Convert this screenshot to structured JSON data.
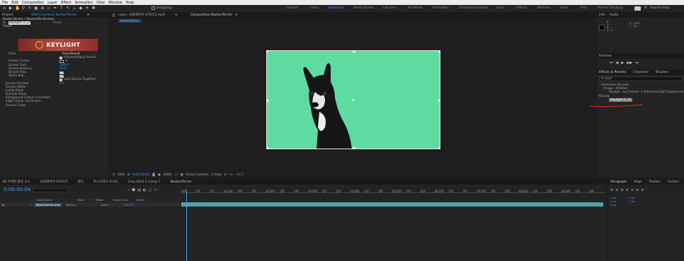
{
  "menubar": [
    "File",
    "Edit",
    "Composition",
    "Layer",
    "Effect",
    "Animation",
    "View",
    "Window",
    "Help"
  ],
  "workspaces": [
    "Default",
    "Learn",
    "Standard",
    "Small Screen",
    "Libraries",
    "All Panels",
    "Animation",
    "Essential Graphics",
    "Color",
    "Effects",
    "Minimal",
    "Paint",
    "Text",
    "Motion Tracking"
  ],
  "toolbar": {
    "snapping_label": "Snapping",
    "search_placeholder": "Search Help"
  },
  "effect_controls": {
    "tab_project": "Project",
    "tab_label": "Effect Controls BostonTerrier",
    "header": "BostonTerrier • BostonTerrier.mov",
    "effect_name": "Keylight (1.2)",
    "reset_label": "Reset",
    "about_label": "About",
    "logo_text": "KEYLIGHT",
    "props": [
      {
        "name": "View",
        "value": "Final Result"
      },
      {
        "name": "",
        "value": "Unpremultiply Result",
        "checkbox": true
      },
      {
        "name": "Screen Colour",
        "value": ""
      },
      {
        "name": "Screen Gain",
        "value": "100.0"
      },
      {
        "name": "Screen Balance",
        "value": "50.0"
      },
      {
        "name": "Despill Bias",
        "value": ""
      },
      {
        "name": "Alpha Bias",
        "value": ""
      },
      {
        "name": "",
        "value": "Lock Biases Together",
        "checkbox": true
      },
      {
        "name": "Screen Pre-blur",
        "value": "0.0"
      },
      {
        "name": "Screen Matte",
        "value": ""
      },
      {
        "name": "Inside Mask",
        "value": ""
      },
      {
        "name": "Outside Mask",
        "value": ""
      },
      {
        "name": "Foreground Colour Correction",
        "value": ""
      },
      {
        "name": "Edge Colour Correction",
        "value": ""
      },
      {
        "name": "Source Crops",
        "value": ""
      }
    ]
  },
  "viewer": {
    "tab_layer": "Layer: 보정레이어-모자이크.mp4",
    "tab_comp": "Composition BostonTerrier",
    "comp_chip": "BostonTerrier",
    "zoom": "50%",
    "timecode": "0:00:00:04",
    "resolution": "(Half)",
    "camera": "Active Camera",
    "views": "1 View",
    "offset": "+0.0"
  },
  "right_panel": {
    "tab_info": "Info",
    "tab_audio": "Audio",
    "info_lines": [
      "R :",
      "G :",
      "B :",
      "A : 0"
    ],
    "info_xy": [
      "X : 2424",
      "Y : 30"
    ],
    "tab_preview": "Preview",
    "tab_effects": "Effects & Presets",
    "tab_character": "Character",
    "tab_brushes": "Brushes",
    "search_value": "keyli",
    "tree": [
      {
        "label": "* Animation Presets",
        "indent": 0
      },
      {
        "label": "Image - Utilities",
        "indent": 1
      },
      {
        "label": "Keyligh...ey Cleaner + Advanced Spill Suppressor",
        "indent": 2
      },
      {
        "label": "Keying",
        "indent": 0
      },
      {
        "label": "Keylight (1.2)",
        "indent": 2,
        "selected": true
      }
    ]
  },
  "timeline": {
    "tabs": [
      "3D 트래킹 합성 소스",
      "보정레이어-모자이크",
      "렌더",
      "마스크리브 모니터",
      "Gray Solid 2 Comp 1",
      "BostonTerrier"
    ],
    "timecode": "0:00:00:04",
    "search_placeholder": "",
    "columns": [
      "Source Name",
      "Mode",
      "T",
      "TrkMat",
      "Parent & Link",
      "Stretch"
    ],
    "layer": {
      "num": "1",
      "name": "BostonTerrier.mov",
      "mode": "Normal",
      "parent": "None",
      "stretch": "100.0%"
    },
    "ticks": [
      "00f",
      "10f",
      "20f",
      "01:00f",
      "10f",
      "20f",
      "02:00f",
      "10f",
      "20f",
      "03:00f",
      "10f",
      "20f",
      "04:00f",
      "10f",
      "20f",
      "05:00f",
      "10f",
      "20f",
      "06:00f",
      "10f",
      "20f",
      "07:00f",
      "10f",
      "20f",
      "08:00f",
      "10f",
      "20f",
      "09:00f",
      "10f",
      "20f"
    ]
  },
  "paragraph": {
    "tab_paragraph": "Paragraph",
    "tab_align": "Align",
    "tab_tracker": "Tracker",
    "tab_content": "Conten",
    "values": [
      "0 px",
      "0 px",
      "0 px",
      "0 px",
      "0 px"
    ]
  },
  "colors": {
    "accent": "#3e9bff",
    "green_screen": "#5fdba2",
    "annotation": "#e02020"
  }
}
